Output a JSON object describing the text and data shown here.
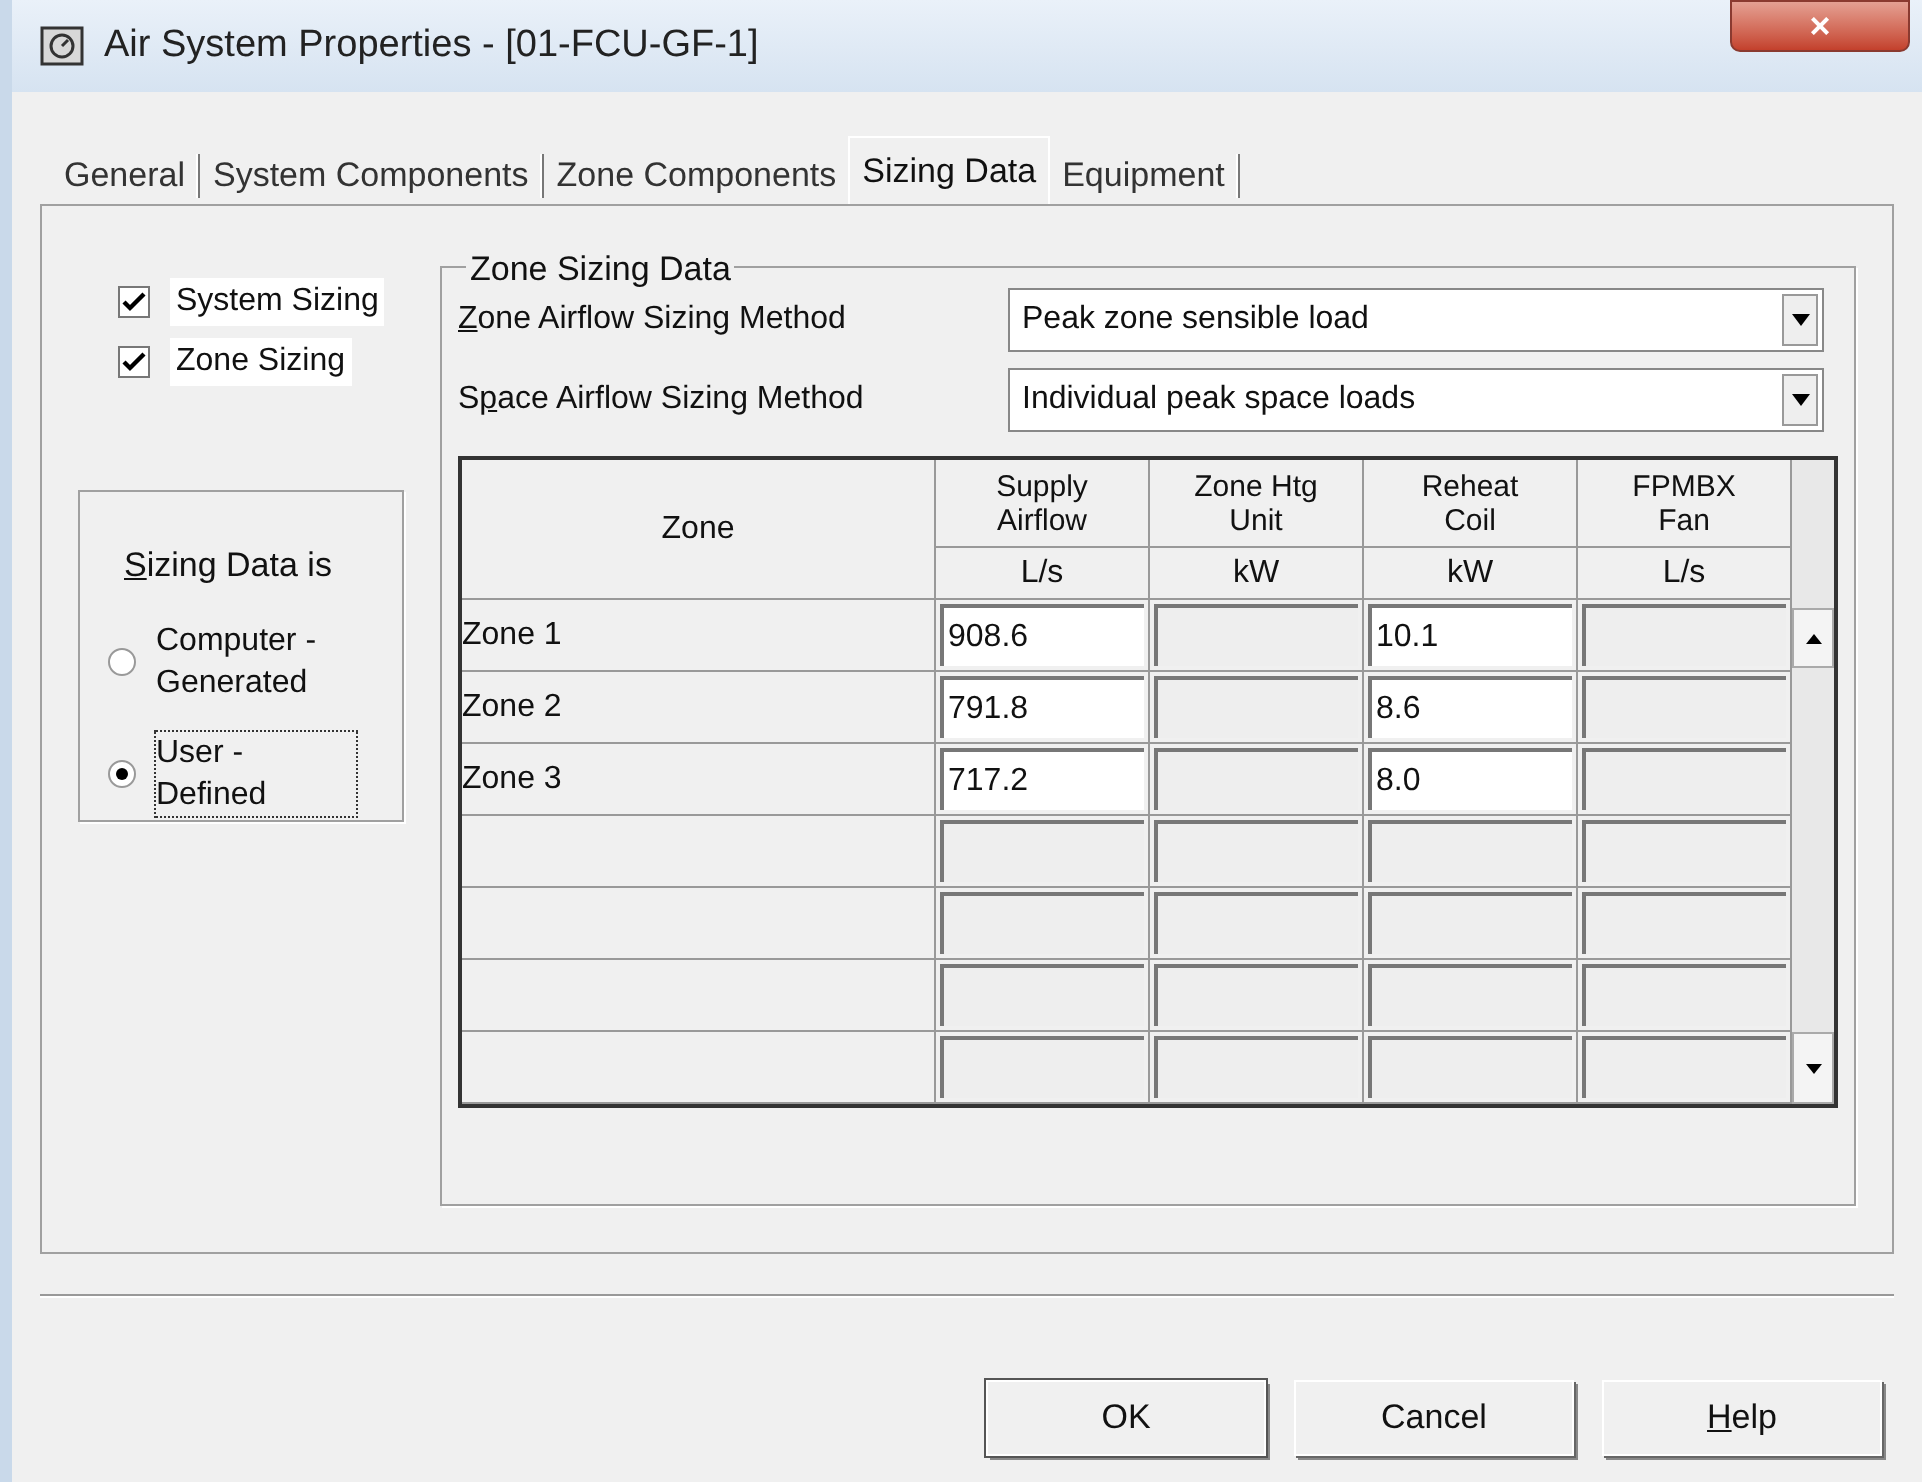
{
  "window": {
    "title": "Air System Properties - [01-FCU-GF-1]",
    "close": "×"
  },
  "tabs": [
    {
      "label": "General",
      "selected": false
    },
    {
      "label": "System Components",
      "selected": false
    },
    {
      "label": "Zone Components",
      "selected": false
    },
    {
      "label": "Sizing Data",
      "selected": true
    },
    {
      "label": "Equipment",
      "selected": false
    }
  ],
  "options": [
    {
      "label": "System Sizing",
      "checked": true
    },
    {
      "label": "Zone Sizing",
      "checked": true
    }
  ],
  "sizing_source": {
    "title": {
      "key": "S",
      "after": "izing Data is"
    },
    "choices": [
      {
        "label": "Computer - Generated",
        "selected": false,
        "focused": false
      },
      {
        "label": "User - Defined",
        "selected": true,
        "focused": true
      }
    ]
  },
  "zone_sizing": {
    "title": "Zone Sizing Data",
    "methods": [
      {
        "label": {
          "key": "Z",
          "after": "one Airflow Sizing Method"
        },
        "value": "Peak zone sensible load"
      },
      {
        "label": {
          "before": "S",
          "key": "p",
          "after": "ace Airflow Sizing Method"
        },
        "value": "Individual peak space loads"
      }
    ],
    "table": {
      "zone_column": "Zone",
      "columns": [
        {
          "name": "Supply Airflow",
          "unit": "L/s"
        },
        {
          "name": "Zone Htg Unit",
          "unit": "kW"
        },
        {
          "name": "Reheat Coil",
          "unit": "kW"
        },
        {
          "name": "FPMBX Fan",
          "unit": "L/s"
        }
      ],
      "rows": [
        {
          "zone": "Zone 1",
          "cells": [
            "908.6",
            null,
            "10.1",
            null
          ]
        },
        {
          "zone": "Zone 2",
          "cells": [
            "791.8",
            null,
            "8.6",
            null
          ]
        },
        {
          "zone": "Zone 3",
          "cells": [
            "717.2",
            null,
            "8.0",
            null
          ]
        }
      ]
    }
  },
  "buttons": [
    {
      "label": {
        "after": "OK"
      },
      "default": true
    },
    {
      "label": {
        "after": "Cancel"
      },
      "default": false
    },
    {
      "label": {
        "key": "H",
        "after": "elp"
      },
      "default": false
    }
  ]
}
